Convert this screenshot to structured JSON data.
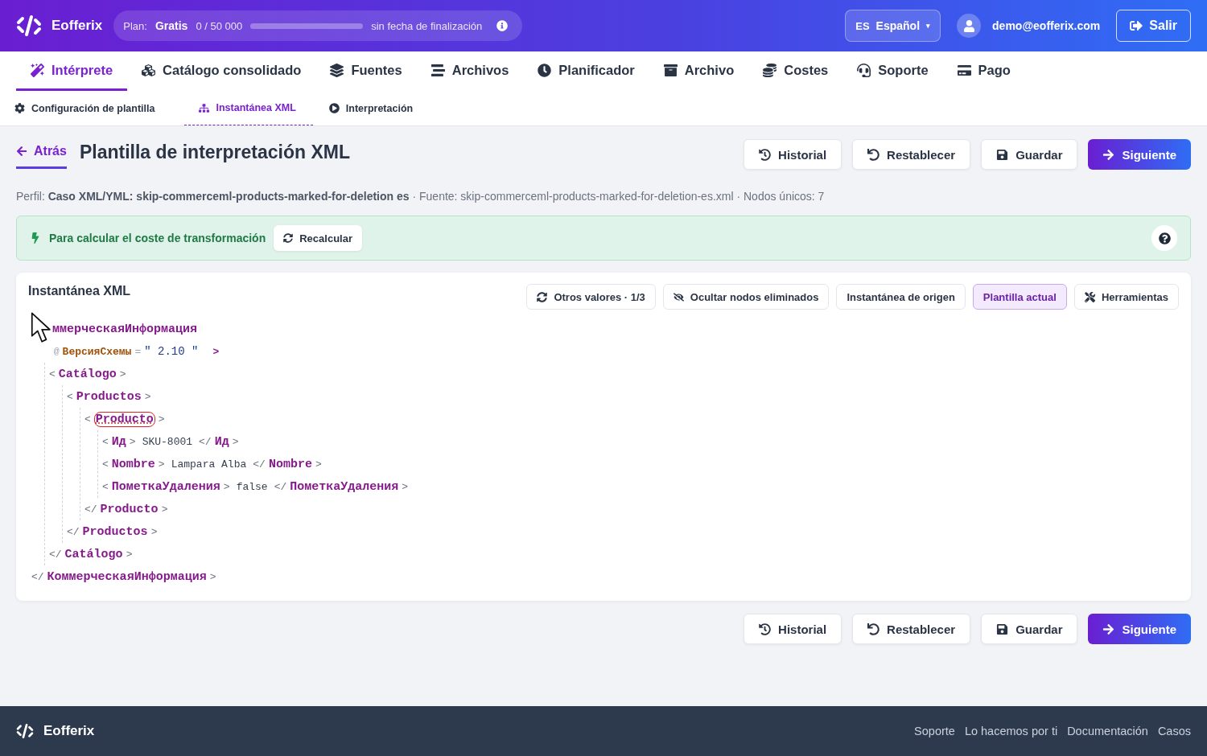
{
  "header": {
    "logo": "Eofferix",
    "plan": {
      "label": "Plan:",
      "name": "Gratis",
      "usage": "0 / 50 000",
      "level": 0,
      "expiry": "sin fecha de finalización"
    },
    "language": {
      "code": "ES",
      "name": "Español",
      "caret": "▾"
    },
    "user": "demo@eofferix.com",
    "logout": "Salir"
  },
  "nav": [
    {
      "label": "Intérprete",
      "selected": true
    },
    {
      "label": "Catálogo consolidado",
      "selected": false
    },
    {
      "label": "Fuentes",
      "selected": false
    },
    {
      "label": "Archivos",
      "selected": false
    },
    {
      "label": "Planificador",
      "selected": false
    },
    {
      "label": "Archivo",
      "selected": false
    },
    {
      "label": "Costes",
      "selected": false
    },
    {
      "label": "Soporte",
      "selected": false
    },
    {
      "label": "Pago",
      "selected": false
    }
  ],
  "subnav": [
    {
      "label": "Configuración de plantilla",
      "selected": false
    },
    {
      "label": "Instantánea XML",
      "selected": true
    },
    {
      "label": "Interpretación",
      "selected": false
    }
  ],
  "page": {
    "back": "Atrás",
    "title": "Plantilla de interpretación XML",
    "meta": "Perfil: **Caso XML/YML: skip-commerceml-products-marked-for-deletion es** · Fuente: skip-commerceml-products-marked-for-deletion-es.xml · Nodos únicos: 7"
  },
  "actions_top": [
    {
      "label": "Historial",
      "kind": "default"
    },
    {
      "label": "Restablecer",
      "kind": "default"
    },
    {
      "label": "Guardar",
      "kind": "default"
    },
    {
      "label": "Siguiente",
      "kind": "primary"
    }
  ],
  "notice": {
    "text": "Para calcular el coste de transformación",
    "button": "Recalcular"
  },
  "snapshot": {
    "title": "Instantánea XML",
    "tools": [
      {
        "label": "Otros valores · 1/3",
        "selected": false
      },
      {
        "label": "Ocultar nodos eliminados",
        "selected": false
      },
      {
        "label": "Instantánea de origen",
        "selected": false
      },
      {
        "label": "Plantilla actual",
        "selected": true
      },
      {
        "label": "Herramientas",
        "selected": false
      }
    ],
    "syntax": {
      "open": "<",
      "close": ">",
      "end": "</",
      "at": "@",
      "equals": "=",
      "quote": "\""
    },
    "tree": {
      "kind": "element",
      "name": "ммерческаяИнформация",
      "close": "КоммерческаяИнформация",
      "marked": false,
      "open_covered": true,
      "attributes": [
        {
          "name": "ВерсияСхемы",
          "value": "2.10"
        }
      ],
      "children": [
        {
          "kind": "element",
          "name": "Catálogo",
          "close": "Catálogo",
          "marked": false,
          "children": [
            {
              "kind": "element",
              "name": "Productos",
              "close": "Productos",
              "marked": false,
              "children": [
                {
                  "kind": "element",
                  "name": "Producto",
                  "close": "Producto",
                  "marked": true,
                  "children": [
                    {
                      "kind": "leaf",
                      "name": "Ид",
                      "value": "SKU-8001",
                      "close": "Ид"
                    },
                    {
                      "kind": "leaf",
                      "name": "Nombre",
                      "value": "Lampara Alba",
                      "close": "Nombre"
                    },
                    {
                      "kind": "leaf",
                      "name": "ПометкаУдаления",
                      "value": "false",
                      "close": "ПометкаУдаления"
                    }
                  ]
                }
              ]
            }
          ]
        }
      ]
    }
  },
  "actions_bottom": [
    {
      "label": "Historial",
      "kind": "default"
    },
    {
      "label": "Restablecer",
      "kind": "default"
    },
    {
      "label": "Guardar",
      "kind": "default"
    },
    {
      "label": "Siguiente",
      "kind": "primary"
    }
  ],
  "footer": {
    "logo": "Eofferix",
    "links": [
      "Soporte",
      "Lo hacemos por ti",
      "Documentación",
      "Casos"
    ]
  }
}
